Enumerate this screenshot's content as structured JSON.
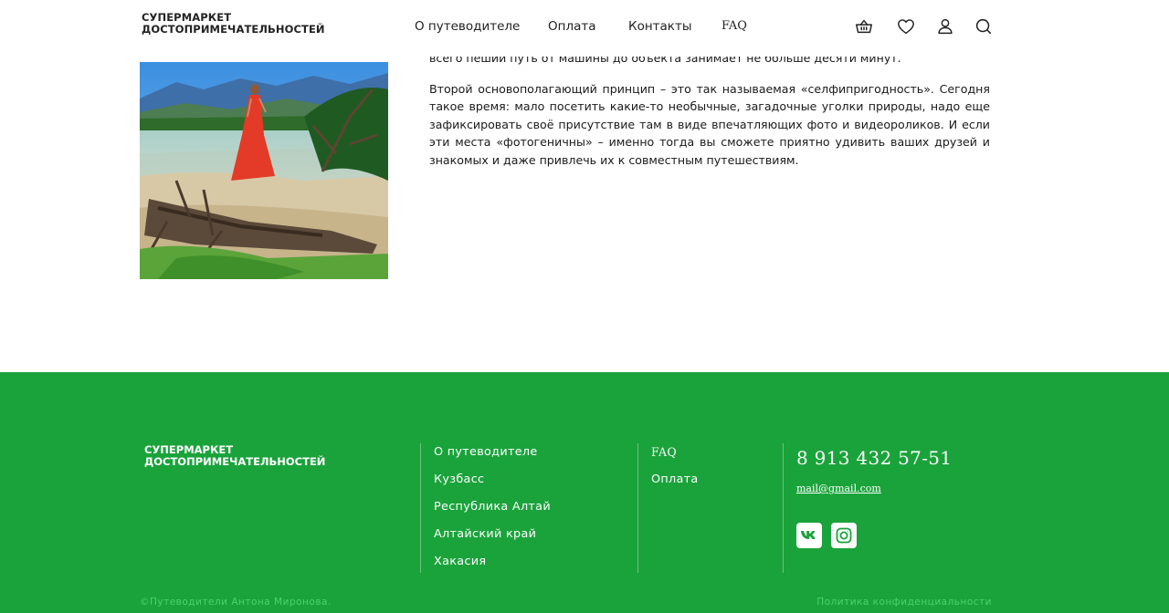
{
  "header": {
    "logo_line1": "СУПЕРМАРКЕТ",
    "logo_line2": "ДОСТОПРИМЕЧАТЕЛЬНОСТЕЙ",
    "nav": {
      "about": "О путеводителе",
      "payment": "Оплата",
      "contacts": "Контакты",
      "faq": "FAQ"
    },
    "icons": [
      "basket-icon",
      "heart-icon",
      "user-icon",
      "search-icon"
    ]
  },
  "article": {
    "paragraph1": "всего пеший путь от машины до объекта занимает не больше десяти минут.",
    "paragraph2": "Второй основополагающий принцип – это так называемая «селфипригодность». Сегодня такое время: мало посетить какие-то необычные, загадочные уголки природы, надо еще зафиксировать своё присутствие там в виде впечатляющих фото и видеороликов. И если эти места «фотогеничны» – именно тогда вы сможете приятно удивить ваших друзей и знакомых и даже привлечь их к совместным путешествиям."
  },
  "footer": {
    "logo_line1": "СУПЕРМАРКЕТ",
    "logo_line2": "ДОСТОПРИМЕЧАТЕЛЬНОСТЕЙ",
    "column1": [
      "О путеводителе",
      "Кузбасс",
      "Республика Алтай",
      "Алтайский край",
      "Хакасия"
    ],
    "column2": [
      "FAQ",
      "Оплата"
    ],
    "phone": "8 913 432 57-51",
    "email": "mail@gmail.com",
    "social": [
      "vk-icon",
      "instagram-icon"
    ],
    "copyright": "©Путеводители Антона Миронова.",
    "policy": "Политика конфиденциальности"
  },
  "colors": {
    "footer_bg": "#1aa33b",
    "footer_muted": "#4cd36a",
    "text": "#222222"
  }
}
